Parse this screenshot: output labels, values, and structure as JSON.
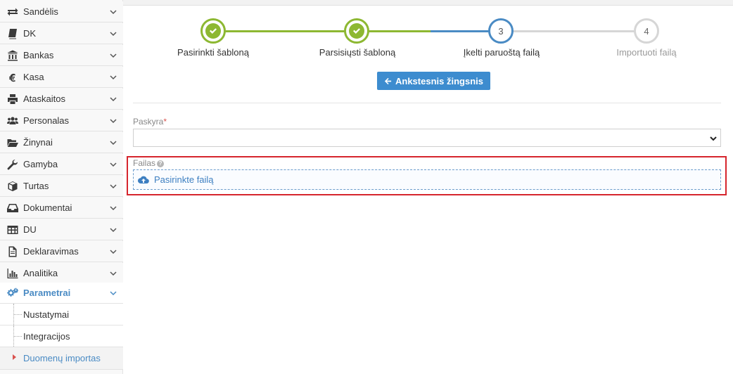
{
  "sidebar": {
    "items": [
      {
        "label": "Sandėlis",
        "icon": "transfer-icon"
      },
      {
        "label": "DK",
        "icon": "book-icon"
      },
      {
        "label": "Bankas",
        "icon": "bank-icon"
      },
      {
        "label": "Kasa",
        "icon": "euro-icon"
      },
      {
        "label": "Ataskaitos",
        "icon": "printer-icon"
      },
      {
        "label": "Personalas",
        "icon": "users-icon"
      },
      {
        "label": "Žinynai",
        "icon": "folder-open-icon"
      },
      {
        "label": "Gamyba",
        "icon": "wrench-icon"
      },
      {
        "label": "Turtas",
        "icon": "cube-icon"
      },
      {
        "label": "Dokumentai",
        "icon": "inbox-icon"
      },
      {
        "label": "DU",
        "icon": "table-icon"
      },
      {
        "label": "Deklaravimas",
        "icon": "document-icon"
      },
      {
        "label": "Analitika",
        "icon": "bar-chart-icon"
      },
      {
        "label": "Parametrai",
        "icon": "gears-icon"
      }
    ],
    "subitems": [
      {
        "label": "Nustatymai"
      },
      {
        "label": "Integracijos"
      },
      {
        "label": "Duomenų importas"
      }
    ],
    "active_color": "#4a8bc4"
  },
  "wizard": {
    "steps": [
      {
        "label": "Pasirinkti šabloną",
        "state": "done"
      },
      {
        "label": "Parsisiųsti šabloną",
        "state": "done"
      },
      {
        "number": "3",
        "label": "Įkelti paruoštą failą",
        "state": "current"
      },
      {
        "number": "4",
        "label": "Importuoti failą",
        "state": "future"
      }
    ],
    "colors": {
      "done": "#8db832",
      "current": "#4a8bc4",
      "future": "#d6d6d6"
    },
    "back_button": "Ankstesnis žingsnis"
  },
  "form": {
    "account_label": "Paskyra",
    "account_required": "*",
    "account_value": "",
    "file_label": "Failas",
    "file_help": "?",
    "file_button": "Pasirinkte failą"
  }
}
